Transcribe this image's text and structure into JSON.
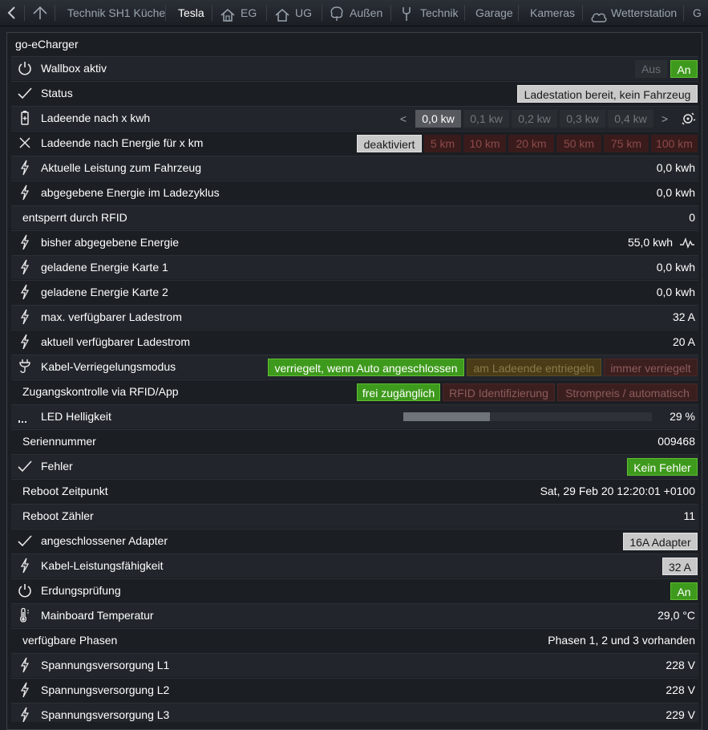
{
  "nav": {
    "tabs": [
      {
        "label": "Technik SH1 Küche",
        "icon": ""
      },
      {
        "label": "Tesla",
        "icon": "",
        "active": true
      },
      {
        "label": "EG",
        "icon": "house-icon"
      },
      {
        "label": "UG",
        "icon": "house-outline-icon"
      },
      {
        "label": "Außen",
        "icon": "tree-icon"
      },
      {
        "label": "Technik",
        "icon": "wrench-icon"
      },
      {
        "label": "Garage",
        "icon": ""
      },
      {
        "label": "Kameras",
        "icon": ""
      },
      {
        "label": "Wetterstation",
        "icon": "cloud-icon"
      },
      {
        "label": "G",
        "icon": ""
      }
    ]
  },
  "panel": {
    "title": "go-eCharger"
  },
  "rows": {
    "wallbox": {
      "label": "Wallbox aktiv",
      "off": "Aus",
      "on": "An"
    },
    "status": {
      "label": "Status",
      "value": "Ladestation bereit, kein Fahrzeug"
    },
    "ladeende_kwh": {
      "label": "Ladeende nach x kwh",
      "prev": "<",
      "next": ">",
      "options": [
        "0,0 kw",
        "0,1 kw",
        "0,2 kw",
        "0,3 kw",
        "0,4 kw"
      ],
      "selected_index": 0
    },
    "ladeende_km": {
      "label": "Ladeende nach Energie für x km",
      "options": [
        "deaktiviert",
        "5 km",
        "10 km",
        "20 km",
        "50 km",
        "75 km",
        "100 km"
      ]
    },
    "leistung": {
      "label": "Aktuelle Leistung zum Fahrzeug",
      "value": "0,0 kwh"
    },
    "abgegeben_zyklus": {
      "label": "abgegebene Energie im Ladezyklus",
      "value": "0,0 kwh"
    },
    "rfid": {
      "label": "entsperrt durch RFID",
      "value": "0"
    },
    "bisher": {
      "label": "bisher abgegebene Energie",
      "value": "55,0 kwh"
    },
    "karte1": {
      "label": "geladene Energie Karte 1",
      "value": "0,0 kwh"
    },
    "karte2": {
      "label": "geladene Energie Karte 2",
      "value": "0,0 kwh"
    },
    "max_strom": {
      "label": "max. verfügbarer Ladestrom",
      "value": "32 A"
    },
    "akt_strom": {
      "label": "aktuell verfügbarer Ladestrom",
      "value": "20 A"
    },
    "kabel_modus": {
      "label": "Kabel-Verriegelungsmodus",
      "options": [
        "verriegelt, wenn Auto angeschlossen",
        "am Ladeende entriegeln",
        "immer verriegelt"
      ]
    },
    "zugang": {
      "label": "Zugangskontrolle via RFID/App",
      "options": [
        "frei zugänglich",
        "RFID Identifizierung",
        "Strompreis / automatisch"
      ]
    },
    "led": {
      "label": "LED Helligkeit",
      "value": "29 %",
      "level": 0.29
    },
    "seriennummer": {
      "label": "Seriennummer",
      "value": "009468"
    },
    "fehler": {
      "label": "Fehler",
      "value": "Kein Fehler"
    },
    "reboot_zeit": {
      "label": "Reboot Zeitpunkt",
      "value": "Sat, 29 Feb 20 12:20:01 +0100"
    },
    "reboot_zaehler": {
      "label": "Reboot Zähler",
      "value": "11"
    },
    "adapter": {
      "label": "angeschlossener Adapter",
      "value": "16A Adapter"
    },
    "kabel_leistung": {
      "label": "Kabel-Leistungsfähigkeit",
      "value": "32 A"
    },
    "erdung": {
      "label": "Erdungsprüfung",
      "value": "An"
    },
    "temperatur": {
      "label": "Mainboard Temperatur",
      "value": "29,0 °C"
    },
    "phasen": {
      "label": "verfügbare Phasen",
      "value": "Phasen 1, 2 und 3 vorhanden"
    },
    "l1": {
      "label": "Spannungsversorgung L1",
      "value": "228 V"
    },
    "l2": {
      "label": "Spannungsversorgung L2",
      "value": "228 V"
    },
    "l3": {
      "label": "Spannungsversorgung L3",
      "value": "229 V"
    }
  },
  "colors": {
    "background": "#1d2026",
    "green": "#3e9a1c",
    "accent_text": "#ffffff"
  }
}
